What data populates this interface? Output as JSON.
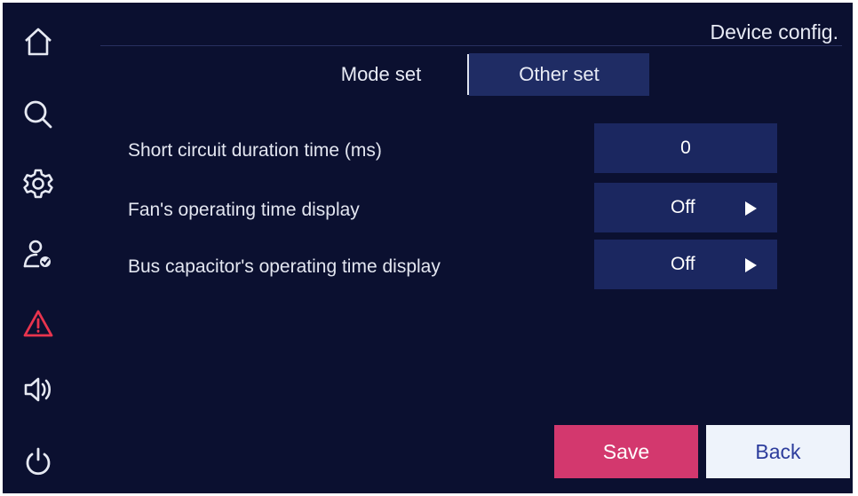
{
  "header": {
    "title": "Device config."
  },
  "sidebar": {
    "items": [
      {
        "icon": "home-icon"
      },
      {
        "icon": "search-icon"
      },
      {
        "icon": "gear-icon"
      },
      {
        "icon": "user-check-icon"
      },
      {
        "icon": "warning-icon",
        "color": "#e8344e"
      },
      {
        "icon": "speaker-icon"
      },
      {
        "icon": "power-icon"
      }
    ]
  },
  "tabs": [
    {
      "label": "Mode set",
      "active": false
    },
    {
      "label": "Other set",
      "active": true
    }
  ],
  "settings": [
    {
      "label": "Short circuit duration time (ms)",
      "value": "0"
    },
    {
      "label": "Fan's operating time display",
      "value": "Off"
    },
    {
      "label": "Bus capacitor's operating time display",
      "value": "Off"
    }
  ],
  "footer": {
    "save_label": "Save",
    "back_label": "Back"
  },
  "colors": {
    "background": "#0b1030",
    "panel": "#1b2760",
    "save": "#d3386e",
    "back": "#eef3fb",
    "warning": "#e8344e"
  }
}
